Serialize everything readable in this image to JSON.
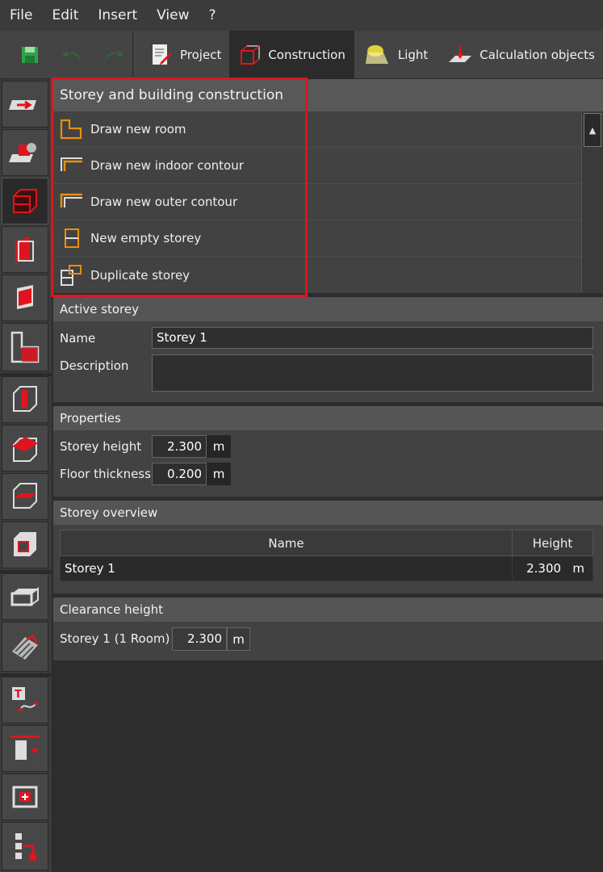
{
  "menu": [
    "File",
    "Edit",
    "Insert",
    "View",
    "?"
  ],
  "toolbar": {
    "save_icon": "save-icon",
    "undo_icon": "undo-icon",
    "redo_icon": "redo-icon",
    "tabs": [
      {
        "label": "Project",
        "icon": "project-icon"
      },
      {
        "label": "Construction",
        "icon": "construction-icon"
      },
      {
        "label": "Light",
        "icon": "light-icon"
      },
      {
        "label": "Calculation objects",
        "icon": "calculation-icon"
      }
    ],
    "active_tab": "Construction"
  },
  "rail": [
    "arrow-tool-icon",
    "furniture-icon",
    "construction-icon",
    "wall-icon",
    "door-icon",
    "room-icon",
    "column-icon",
    "roof-icon",
    "floor-icon",
    "ceiling-icon",
    "window-icon",
    "stairs-icon",
    "text-icon",
    "luminaire-icon",
    "calc-surface-icon",
    "measure-icon"
  ],
  "construction": {
    "title": "Storey and building construction",
    "commands": [
      {
        "label": "Draw new room",
        "icon": "room-draw-icon"
      },
      {
        "label": "Draw new indoor contour",
        "icon": "indoor-contour-icon"
      },
      {
        "label": "Draw new outer contour",
        "icon": "outer-contour-icon"
      },
      {
        "label": "New empty storey",
        "icon": "empty-storey-icon"
      },
      {
        "label": "Duplicate storey",
        "icon": "duplicate-storey-icon"
      }
    ],
    "scroll_up": "▲"
  },
  "active_storey": {
    "title": "Active storey",
    "name_label": "Name",
    "name_value": "Storey 1",
    "description_label": "Description",
    "description_value": ""
  },
  "properties": {
    "title": "Properties",
    "height_label": "Storey height",
    "height_value": "2.300",
    "height_unit": "m",
    "floor_label": "Floor thickness",
    "floor_value": "0.200",
    "floor_unit": "m"
  },
  "overview": {
    "title": "Storey overview",
    "columns": [
      "Name",
      "Height"
    ],
    "rows": [
      {
        "name": "Storey 1",
        "height": "2.300",
        "unit": "m"
      }
    ]
  },
  "clearance": {
    "title": "Clearance height",
    "label": "Storey 1 (1 Room)",
    "value": "2.300",
    "unit": "m"
  },
  "colors": {
    "accent": "#e0141e",
    "orange": "#e8900c",
    "green": "#2fa34a"
  }
}
